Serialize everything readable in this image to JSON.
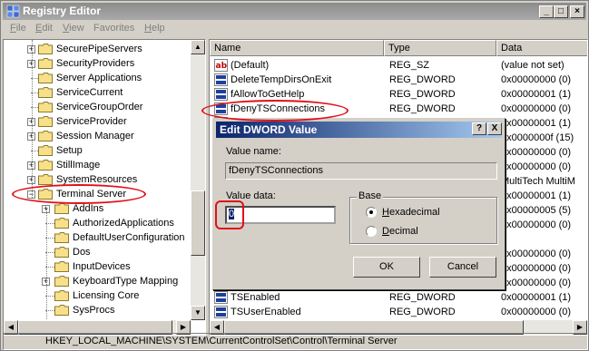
{
  "window": {
    "title": "Registry Editor"
  },
  "menu": [
    {
      "label": "File",
      "key": "F",
      "rest": "ile"
    },
    {
      "label": "Edit",
      "key": "E",
      "rest": "dit"
    },
    {
      "label": "View",
      "key": "V",
      "rest": "iew"
    },
    {
      "label": "Favorites",
      "key": "",
      "rest": "Favorites"
    },
    {
      "label": "Help",
      "key": "H",
      "rest": "elp"
    }
  ],
  "tree": [
    {
      "label": "SecurePipeServers",
      "expander": "+"
    },
    {
      "label": "SecurityProviders",
      "expander": "+"
    },
    {
      "label": "Server Applications",
      "expander": ""
    },
    {
      "label": "ServiceCurrent",
      "expander": ""
    },
    {
      "label": "ServiceGroupOrder",
      "expander": ""
    },
    {
      "label": "ServiceProvider",
      "expander": "+"
    },
    {
      "label": "Session Manager",
      "expander": "+"
    },
    {
      "label": "Setup",
      "expander": ""
    },
    {
      "label": "StillImage",
      "expander": "+"
    },
    {
      "label": "SystemResources",
      "expander": "+"
    },
    {
      "label": "Terminal Server",
      "expander": "−"
    },
    {
      "label": "AddIns",
      "expander": "+"
    },
    {
      "label": "AuthorizedApplications",
      "expander": ""
    },
    {
      "label": "DefaultUserConfiguration",
      "expander": ""
    },
    {
      "label": "Dos",
      "expander": ""
    },
    {
      "label": "InputDevices",
      "expander": ""
    },
    {
      "label": "KeyboardType Mapping",
      "expander": "+"
    },
    {
      "label": "Licensing Core",
      "expander": ""
    },
    {
      "label": "SysProcs",
      "expander": ""
    }
  ],
  "list": {
    "headers": [
      "Name",
      "Type",
      "Data"
    ],
    "rows": [
      {
        "icon": "string",
        "name": "(Default)",
        "type": "REG_SZ",
        "data": "(value not set)"
      },
      {
        "icon": "binary",
        "name": "DeleteTempDirsOnExit",
        "type": "REG_DWORD",
        "data": "0x00000000 (0)"
      },
      {
        "icon": "binary",
        "name": "fAllowToGetHelp",
        "type": "REG_DWORD",
        "data": "0x00000001 (1)"
      },
      {
        "icon": "binary",
        "name": "fDenyTSConnections",
        "type": "REG_DWORD",
        "data": "0x00000000 (0)"
      },
      {
        "icon": "binary",
        "name": "",
        "type": "",
        "data": "0x00000001 (1)"
      },
      {
        "icon": "binary",
        "name": "",
        "type": "",
        "data": "0x0000000f (15)"
      },
      {
        "icon": "binary",
        "name": "",
        "type": "",
        "data": "0x00000000 (0)"
      },
      {
        "icon": "binary",
        "name": "",
        "type": "",
        "data": "0x00000000 (0)"
      },
      {
        "icon": "binary",
        "name": "",
        "type": "",
        "data": "MultiTech MultiM"
      },
      {
        "icon": "binary",
        "name": "",
        "type": "",
        "data": "0x00000001 (1)"
      },
      {
        "icon": "binary",
        "name": "",
        "type": "",
        "data": "0x00000005 (5)"
      },
      {
        "icon": "binary",
        "name": "",
        "type": "",
        "data": "0x00000000 (0)"
      },
      {
        "icon": "binary",
        "name": "",
        "type": "",
        "data": "1"
      },
      {
        "icon": "binary",
        "name": "",
        "type": "",
        "data": "0x00000000 (0)"
      },
      {
        "icon": "binary",
        "name": "",
        "type": "",
        "data": "0x00000000 (0)"
      },
      {
        "icon": "binary",
        "name": "",
        "type": "",
        "data": "0x00000000 (0)"
      },
      {
        "icon": "binary",
        "name": "TSEnabled",
        "type": "REG_DWORD",
        "data": "0x00000001 (1)"
      },
      {
        "icon": "binary",
        "name": "TSUserEnabled",
        "type": "REG_DWORD",
        "data": "0x00000000 (0)"
      }
    ]
  },
  "dialog": {
    "title": "Edit DWORD Value",
    "value_name_label": "Value name:",
    "value_name": "fDenyTSConnections",
    "value_data_label": "Value data:",
    "value_data": "0",
    "base_label": "Base",
    "hex_label": "Hexadecimal",
    "hex_key": "H",
    "dec_label": "Decimal",
    "dec_key": "D",
    "ok_label": "OK",
    "cancel_label": "Cancel",
    "help_glyph": "?",
    "close_glyph": "X",
    "selected_base": "Hexadecimal"
  },
  "status": {
    "path": "HKEY_LOCAL_MACHINE\\SYSTEM\\CurrentControlSet\\Control\\Terminal Server"
  },
  "colors": {
    "callout": "#e0101a",
    "dialog_title": "#0a246a"
  }
}
